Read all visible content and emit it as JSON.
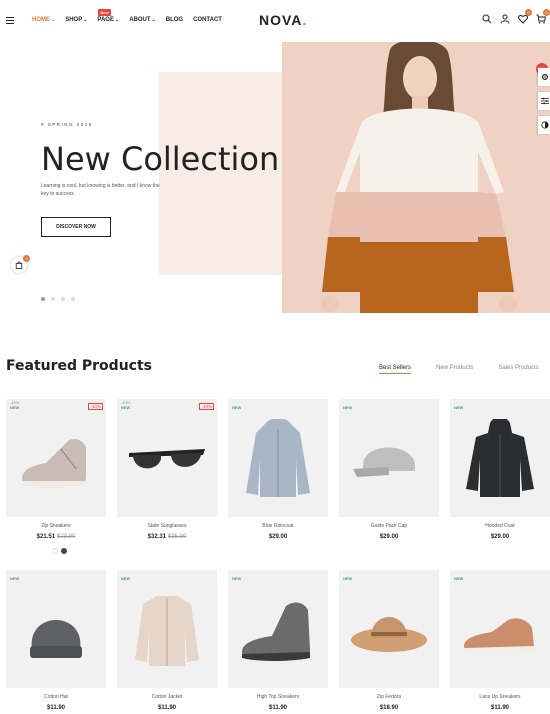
{
  "header": {
    "nav": [
      {
        "label": "HOME",
        "caret": "⌄",
        "active": true
      },
      {
        "label": "SHOP",
        "caret": "⌄"
      },
      {
        "label": "PAGE",
        "caret": "⌄",
        "badge": "New"
      },
      {
        "label": "ABOUT",
        "caret": "⌄"
      },
      {
        "label": "BLOG"
      },
      {
        "label": "CONTACT"
      }
    ],
    "logo": "NOVA",
    "logo_dot": ".",
    "wishlist_count": "0",
    "cart_count": "0"
  },
  "hero": {
    "subtitle": "# SPRING 2019",
    "title": "New Collection",
    "description": "Learning is cool, but knowing is better, and I know the key to success",
    "button": "DISCOVER NOW",
    "floating_cart_count": "0"
  },
  "side_tools": {
    "badge": "NEW"
  },
  "featured": {
    "title": "Featured Products",
    "tabs": [
      "Best Sellers",
      "New Products",
      "Sales Products"
    ],
    "products": [
      {
        "name": "Zip Sneakers",
        "price": "$21.51",
        "old_price": "$23.90",
        "tag": "NEW",
        "off": "-10%",
        "discount": "-10%",
        "icon": "sneaker-icon"
      },
      {
        "name": "State Sunglasses",
        "price": "$32.31",
        "old_price": "$35.90",
        "tag": "NEW",
        "off": "-10%",
        "discount": "-10%",
        "icon": "sunglasses-icon"
      },
      {
        "name": "Blue Raincoat",
        "price": "$29.00",
        "tag": "NEW",
        "icon": "raincoat-icon"
      },
      {
        "name": "Guide Pack Cap",
        "price": "$29.00",
        "tag": "NEW",
        "icon": "cap-icon"
      },
      {
        "name": "Hooded Coat",
        "price": "$29.00",
        "tag": "NEW",
        "icon": "hooded-coat-icon"
      },
      {
        "name": "Cotton Hat",
        "price": "$11.90",
        "tag": "NEW",
        "icon": "beanie-icon"
      },
      {
        "name": "Cotton Jacket",
        "price": "$11.90",
        "tag": "NEW",
        "icon": "jacket-icon"
      },
      {
        "name": "High Top Sneakers",
        "price": "$11.90",
        "tag": "NEW",
        "icon": "boot-icon"
      },
      {
        "name": "Zip Fedora",
        "price": "$18.90",
        "tag": "NEW",
        "icon": "fedora-icon"
      },
      {
        "name": "Lace Up Sneakers",
        "price": "$11.90",
        "tag": "NEW",
        "icon": "lace-sneaker-icon"
      }
    ]
  }
}
